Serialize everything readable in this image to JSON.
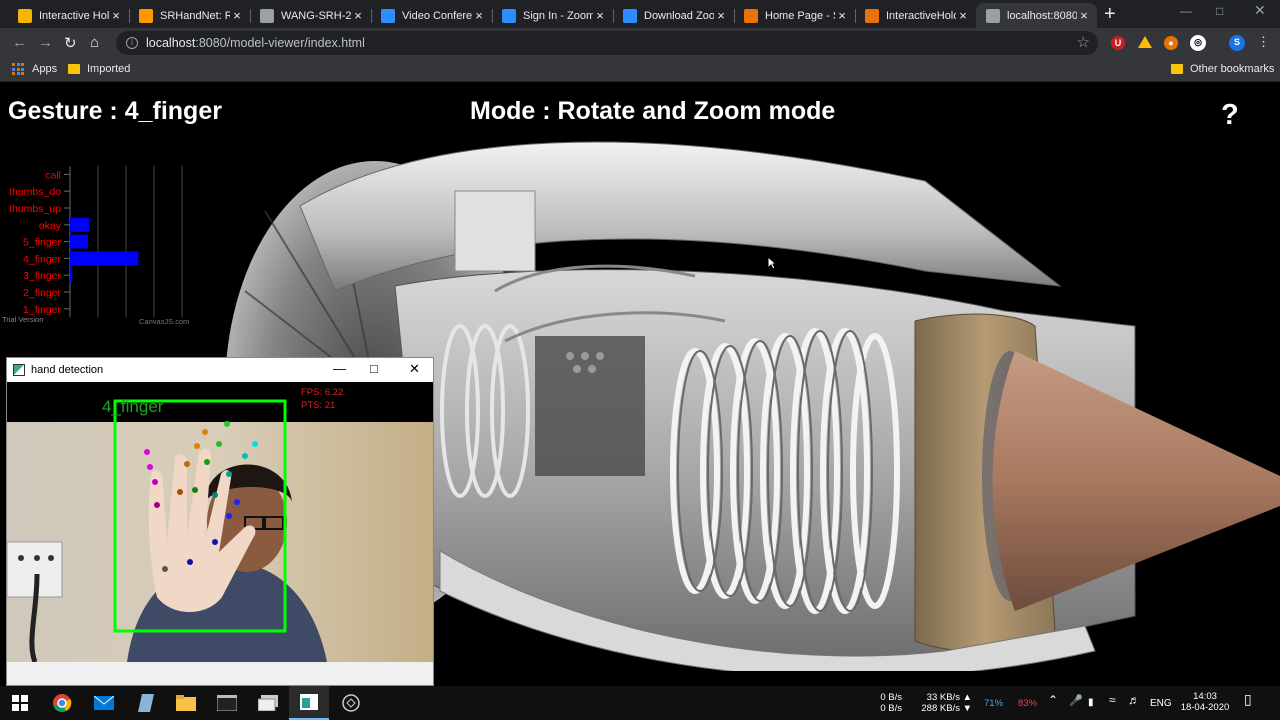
{
  "browser": {
    "tabs": [
      {
        "title": "Interactive Holo",
        "favicon_color": "#f4b400"
      },
      {
        "title": "SRHandNet: Re",
        "favicon_color": "#ff9800"
      },
      {
        "title": "WANG-SRH-20",
        "favicon_color": "#9aa0a6"
      },
      {
        "title": "Video Conferen",
        "favicon_color": "#2d8cff"
      },
      {
        "title": "Sign In - Zoom",
        "favicon_color": "#2d8cff"
      },
      {
        "title": "Download Zoo",
        "favicon_color": "#2d8cff"
      },
      {
        "title": "Home Page - S",
        "favicon_color": "#e8710a"
      },
      {
        "title": "InteractiveHolo",
        "favicon_color": "#e8710a"
      },
      {
        "title": "localhost:8080/",
        "favicon_color": "#9aa0a6",
        "active": true
      }
    ],
    "tab_close_glyph": "×",
    "new_tab_glyph": "+",
    "url_host": "localhost",
    "url_rest": ":8080/model-viewer/index.html",
    "bookmarks": {
      "apps": "Apps",
      "imported": "Imported",
      "other": "Other bookmarks"
    },
    "profile_initial": "S"
  },
  "page": {
    "gesture_label": "Gesture : 4_finger",
    "mode_label": "Mode : Rotate and Zoom mode",
    "help_glyph": "?"
  },
  "chart_data": {
    "type": "bar",
    "orientation": "horizontal",
    "categories": [
      "call",
      "thumbs_do",
      "thumbs_up",
      "okay",
      "5_finger",
      "4_finger",
      "3_finger",
      "2_finger",
      "1_finger"
    ],
    "values": [
      0,
      0,
      0,
      0.17,
      0.16,
      0.61,
      0.02,
      0,
      0
    ],
    "xlim": [
      0,
      1
    ],
    "grid": true,
    "bar_color": "#0000ff",
    "label_color": "#ff0000",
    "watermark_left": "Trial Version",
    "watermark_right": "CanvasJS.com"
  },
  "hand_detection": {
    "window_title": "hand detection",
    "fps_text": "FPS: 6.22",
    "pts_text": "PTS: 21",
    "gesture_overlay": "4_finger",
    "box_color": "#00ff00"
  },
  "taskbar": {
    "net_up": "0 B/s",
    "net_down": "0 B/s",
    "speed_up": "33 KB/s",
    "speed_down": "288 KB/s",
    "cpu": "71%",
    "mem": "83%",
    "lang": "ENG",
    "time": "14:03",
    "date": "18-04-2020"
  }
}
